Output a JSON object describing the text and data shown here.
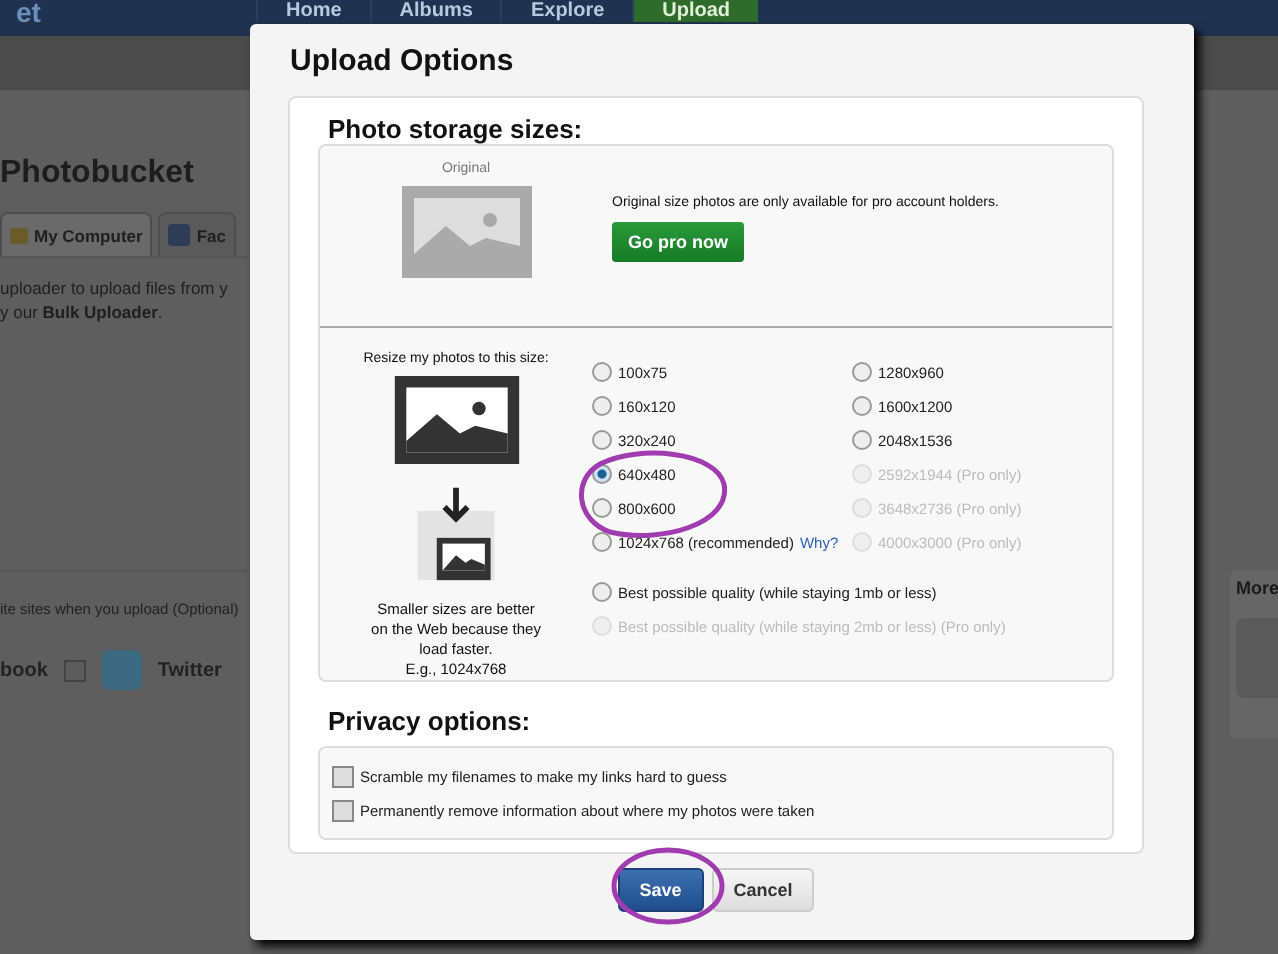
{
  "nav": {
    "logo": "et",
    "items": [
      {
        "label": "Home",
        "selected": false
      },
      {
        "label": "Albums",
        "selected": false
      },
      {
        "label": "Explore",
        "selected": false
      },
      {
        "label": "Upload",
        "selected": true
      }
    ]
  },
  "background": {
    "heading": "Photobucket",
    "tabs": [
      {
        "label": "My Computer",
        "selected": true
      },
      {
        "label": "Fac",
        "selected": false
      }
    ],
    "intro": [
      "uploader to upload files from y",
      "y our **Bulk Uploader**."
    ],
    "share_text": "ite sites when you upload (Optional)",
    "share_options": [
      {
        "label": "book"
      },
      {
        "label": "Twitter",
        "checked": false
      }
    ],
    "more_label": "More"
  },
  "modal": {
    "title": "Upload Options",
    "storage": {
      "heading": "Photo storage sizes:",
      "original": {
        "caption": "Original",
        "note": "Original size photos are only available for pro account holders.",
        "button": "Go pro now"
      },
      "resize": {
        "caption": "Resize my photos to this size:",
        "hint_lines": [
          "Smaller sizes are better",
          "on the Web because they",
          "load faster.",
          "E.g., 1024x768"
        ]
      },
      "size_columns": [
        [
          {
            "label": "100x75",
            "selected": false,
            "disabled": false
          },
          {
            "label": "160x120",
            "selected": false,
            "disabled": false
          },
          {
            "label": "320x240",
            "selected": false,
            "disabled": false
          },
          {
            "label": "640x480",
            "selected": true,
            "disabled": false
          },
          {
            "label": "800x600",
            "selected": false,
            "disabled": false
          },
          {
            "label": "1024x768 (recommended)",
            "selected": false,
            "disabled": false,
            "link": "Why?"
          }
        ],
        [
          {
            "label": "1280x960",
            "selected": false,
            "disabled": false
          },
          {
            "label": "1600x1200",
            "selected": false,
            "disabled": false
          },
          {
            "label": "2048x1536",
            "selected": false,
            "disabled": false
          },
          {
            "label": "2592x1944 (Pro only)",
            "selected": false,
            "disabled": true
          },
          {
            "label": "3648x2736 (Pro only)",
            "selected": false,
            "disabled": true
          },
          {
            "label": "4000x3000 (Pro only)",
            "selected": false,
            "disabled": true
          }
        ]
      ],
      "quality_options": [
        {
          "label": "Best possible quality (while staying 1mb or less)",
          "selected": false,
          "disabled": false
        },
        {
          "label": "Best possible quality (while staying 2mb or less) (Pro only)",
          "selected": false,
          "disabled": true
        }
      ]
    },
    "privacy": {
      "heading": "Privacy options:",
      "options": [
        {
          "label": "Scramble my filenames to make my links hard to guess",
          "checked": false
        },
        {
          "label": "Permanently remove information about where my photos were taken",
          "checked": false
        }
      ]
    },
    "buttons": [
      {
        "label": "Save",
        "kind": "primary"
      },
      {
        "label": "Cancel",
        "kind": "secondary"
      }
    ]
  }
}
